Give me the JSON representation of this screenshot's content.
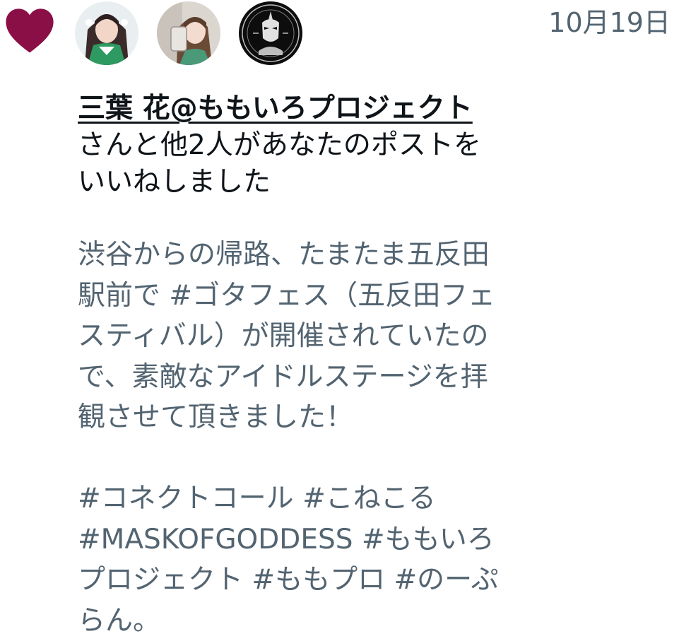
{
  "notification": {
    "type_icon": "heart-icon",
    "heart_color": "#8a0f46",
    "avatars": [
      {
        "icon": "avatar-idol-green-outfit"
      },
      {
        "icon": "avatar-idol-selfie"
      },
      {
        "icon": "avatar-mask-of-goddess-logo"
      }
    ],
    "timestamp": "10月19日",
    "actor_name": "三葉 花@ももいろプロジェクト",
    "summary_rest": "さんと他2人があなたのポストをいいねしました",
    "post": {
      "paragraph_1": "渋谷からの帰路、たまたま五反田駅前で #ゴタフェス（五反田フェスティバル）が開催されていたので、素敵なアイドルステージを拝観させて頂きました！",
      "paragraph_2": "#コネクトコール #こねこる #MASKOFGODDESS #ももいろプロジェクト #ももプロ #のーぷらん。"
    },
    "colors": {
      "primary_text": "#0f1419",
      "secondary_text": "#536471"
    }
  }
}
